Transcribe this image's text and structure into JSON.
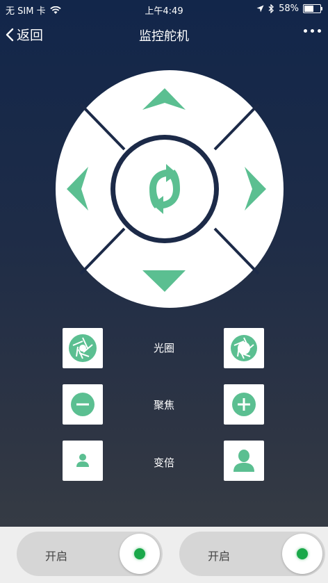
{
  "status_bar": {
    "carrier": "无 SIM 卡",
    "time": "上午4:49",
    "battery_percent": "58%",
    "battery_level": 0.58,
    "icons": [
      "wifi-icon",
      "location-arrow-icon",
      "bluetooth-icon",
      "battery-icon"
    ]
  },
  "nav": {
    "back_label": "返回",
    "title": "监控舵机"
  },
  "joystick": {
    "buttons": [
      "up-arrow",
      "down-arrow",
      "left-arrow",
      "right-arrow",
      "reset-rotate"
    ]
  },
  "controls": [
    {
      "label": "光圈",
      "left_icon": "aperture-small-icon",
      "right_icon": "aperture-large-icon"
    },
    {
      "label": "聚焦",
      "left_icon": "minus-circle-icon",
      "right_icon": "plus-circle-icon"
    },
    {
      "label": "变倍",
      "left_icon": "person-small-icon",
      "right_icon": "person-large-icon"
    }
  ],
  "switches": [
    {
      "label": "开启",
      "state": "on"
    },
    {
      "label": "开启",
      "state": "on"
    }
  ],
  "colors": {
    "accent": "#5bbf91",
    "bg_top": "#12264a",
    "bg_bottom": "#3a3f45",
    "panel": "#ffffff",
    "switch_on": "#1aa84a"
  }
}
